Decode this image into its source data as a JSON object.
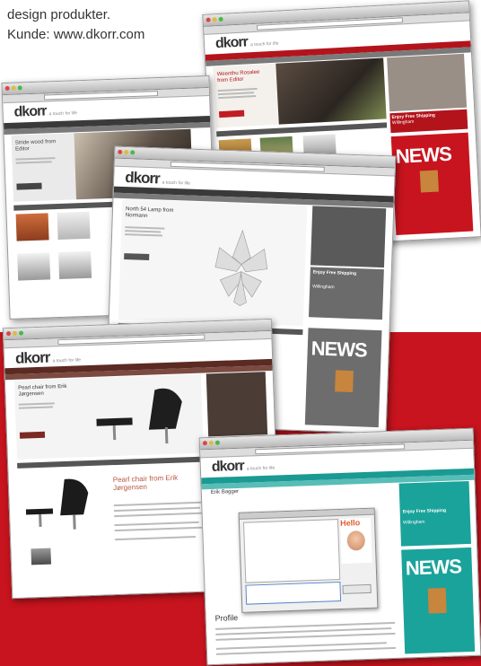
{
  "caption": {
    "line1": "design produkter.",
    "line2": "Kunde: www.dkorr.com"
  },
  "site": {
    "logo": "dkorr",
    "tagline": "a touch for life",
    "news_label": "NEWS",
    "hello_label": "Hello"
  },
  "screens": [
    {
      "hero_title": "Weenthu Rosalee from Editor",
      "promo": "Enjoy Free Shipping",
      "promo_city": "Willingham"
    },
    {
      "hero_title": "Stride wood from Editor"
    },
    {
      "hero_title": "North 54 Lamp from Normann",
      "promo": "Enjoy Free Shipping",
      "promo_city": "Willingham"
    },
    {
      "hero_title": "Pearl chair from Erik Jørgensen",
      "product_title": "Pearl chair from Erik Jørgensen"
    },
    {
      "hero_title": "Erik Bagger",
      "section_title": "Profile",
      "promo": "Enjoy Free Shipping",
      "promo_city": "Willingham"
    }
  ],
  "colors": {
    "brand_red": "#c8141e",
    "teal": "#1aa39a",
    "nav_dark": "#3a3a3a"
  }
}
